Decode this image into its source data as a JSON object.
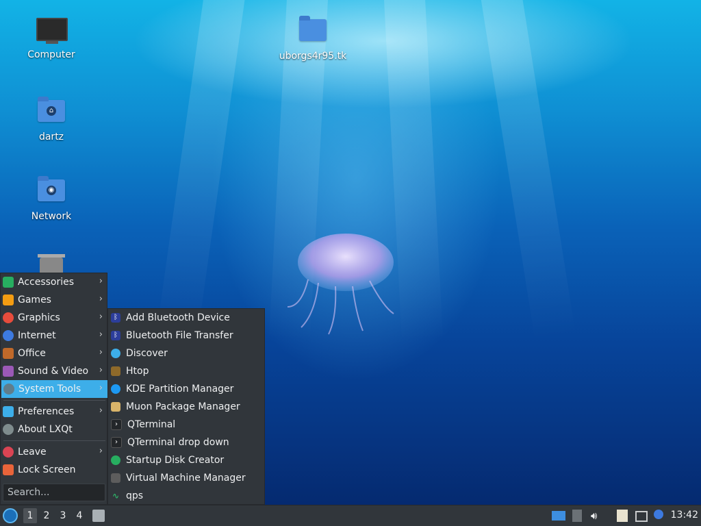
{
  "desktop": {
    "icons": [
      {
        "label": "Computer"
      },
      {
        "label": "uborgs4r95.tk"
      },
      {
        "label": "dartz"
      },
      {
        "label": "Network"
      }
    ]
  },
  "menu": {
    "items": [
      {
        "label": "Accessories",
        "icon": "accessories-icon",
        "color": "#27ae60"
      },
      {
        "label": "Games",
        "icon": "games-icon",
        "color": "#f39c12"
      },
      {
        "label": "Graphics",
        "icon": "graphics-icon",
        "color": "#e74c3c"
      },
      {
        "label": "Internet",
        "icon": "internet-icon",
        "color": "#3d7ae0"
      },
      {
        "label": "Office",
        "icon": "office-icon",
        "color": "#c0692a"
      },
      {
        "label": "Sound & Video",
        "icon": "sound-video-icon",
        "color": "#9b59b6"
      },
      {
        "label": "System Tools",
        "icon": "system-tools-icon",
        "color": "#607d8b"
      },
      {
        "label": "Preferences",
        "icon": "preferences-icon",
        "color": "#3daee9"
      },
      {
        "label": "About LXQt",
        "icon": "about-icon",
        "color": "#7f8c8d"
      },
      {
        "label": "Leave",
        "icon": "leave-icon",
        "color": "#da4453"
      },
      {
        "label": "Lock Screen",
        "icon": "lock-icon",
        "color": "#e9643a"
      }
    ],
    "search_placeholder": "Search..."
  },
  "submenu": {
    "items": [
      {
        "label": "Add Bluetooth Device",
        "icon": "bluetooth-icon",
        "color": "#2c3e9a"
      },
      {
        "label": "Bluetooth File Transfer",
        "icon": "bluetooth-icon",
        "color": "#2c3e9a"
      },
      {
        "label": "Discover",
        "icon": "discover-icon",
        "color": "#3daee9"
      },
      {
        "label": "Htop",
        "icon": "htop-icon",
        "color": "#8e6a2a"
      },
      {
        "label": "KDE Partition Manager",
        "icon": "partition-icon",
        "color": "#1d99f3"
      },
      {
        "label": "Muon Package Manager",
        "icon": "package-icon",
        "color": "#d9b46a"
      },
      {
        "label": "QTerminal",
        "icon": "terminal-icon",
        "color": "#232629"
      },
      {
        "label": "QTerminal drop down",
        "icon": "terminal-icon",
        "color": "#232629"
      },
      {
        "label": "Startup Disk Creator",
        "icon": "startup-disk-icon",
        "color": "#27ae60"
      },
      {
        "label": "Virtual Machine Manager",
        "icon": "vm-icon",
        "color": "#5d5d5d"
      },
      {
        "label": "qps",
        "icon": "qps-icon",
        "color": "#2ecc71"
      }
    ]
  },
  "taskbar": {
    "workspaces": [
      "1",
      "2",
      "3",
      "4"
    ],
    "active_workspace": "1",
    "clock": "13:42"
  }
}
